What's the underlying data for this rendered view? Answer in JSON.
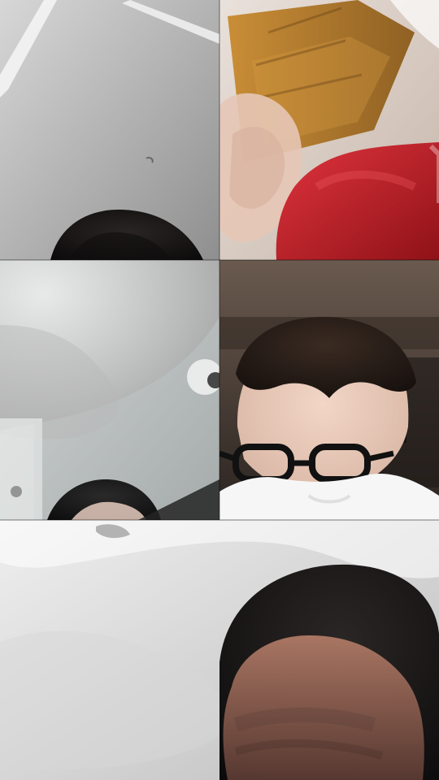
{
  "call": {
    "layout": "video-call-grid",
    "participants": [
      {
        "tile": 1,
        "label": "",
        "content": "ceiling-and-head"
      },
      {
        "tile": 2,
        "label": "",
        "content": "blurred-object-and-red"
      },
      {
        "tile": 3,
        "label": "",
        "content": "ceiling-fan-and-head"
      },
      {
        "tile": 4,
        "label": "",
        "content": "person-with-glasses"
      },
      {
        "tile": 5,
        "label": "",
        "content": "close-up-face"
      }
    ]
  },
  "colors": {
    "wall_gray": "#b8b8b8",
    "wood_tan": "#b37a2e",
    "red_cloth": "#c8242d",
    "glass_black": "#1a1a1a",
    "white_shirt": "#f5f5f5"
  }
}
